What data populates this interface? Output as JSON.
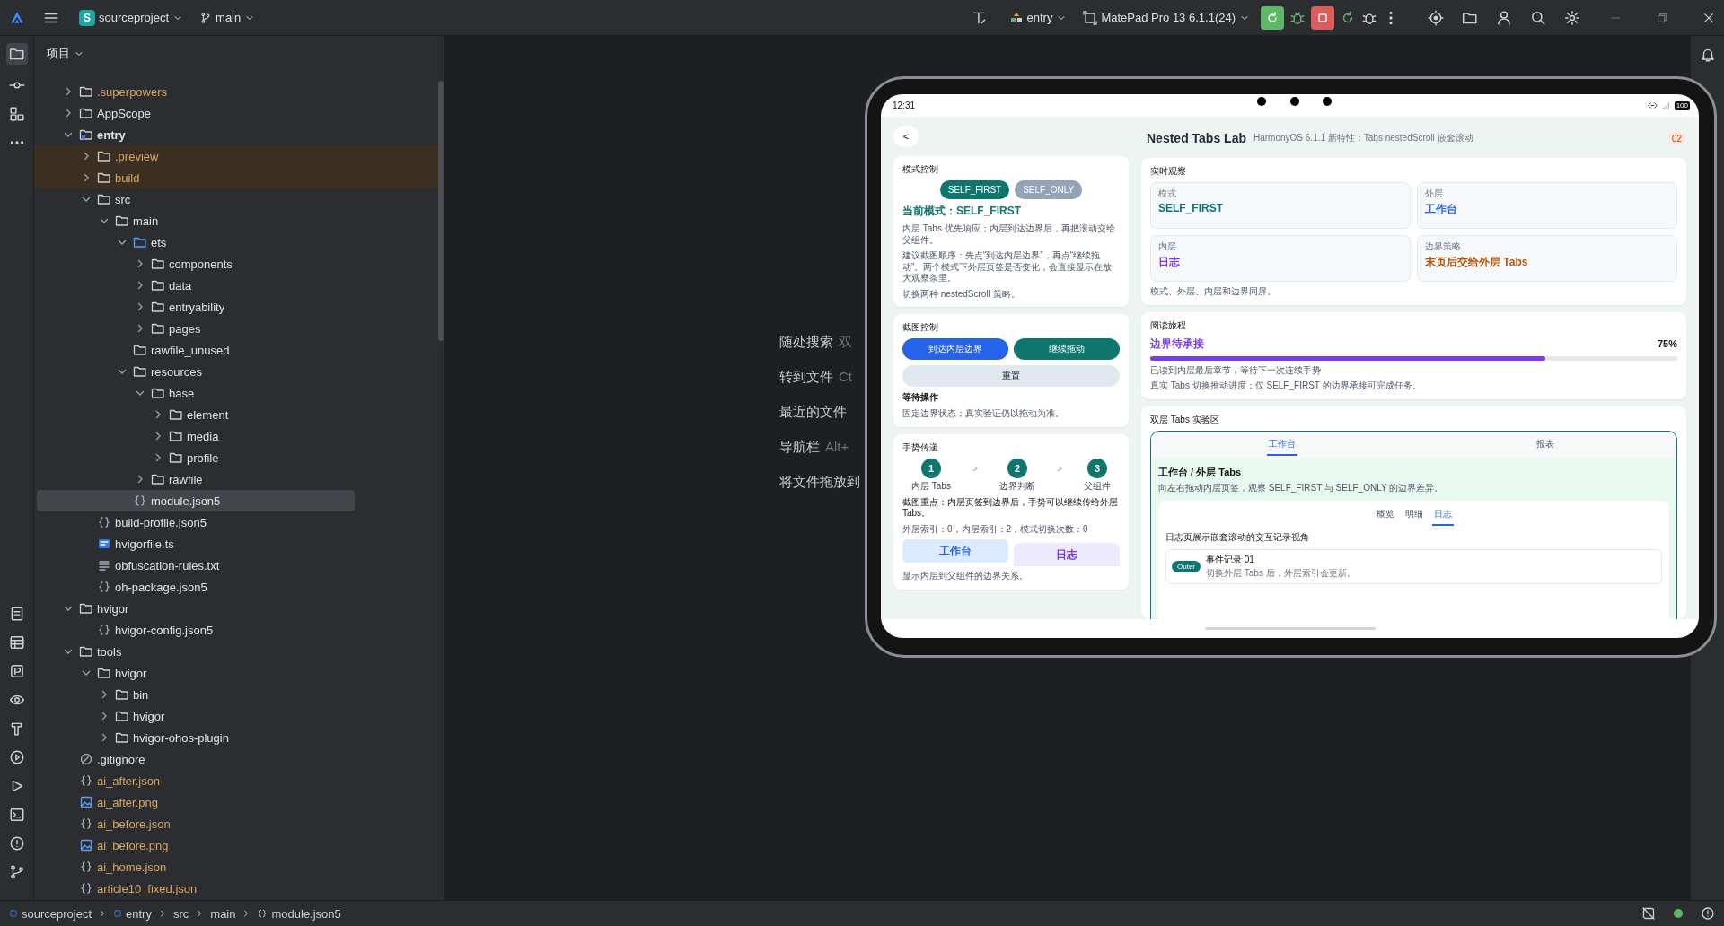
{
  "toolbar": {
    "project_badge": "S",
    "project": "sourceproject",
    "branch": "main",
    "run_config": "entry",
    "device": "MatePad Pro 13 6.1.1(24)"
  },
  "project_panel": {
    "title": "项目",
    "tree": [
      {
        "label": ".superpowers",
        "kind": "folder",
        "ignored": true,
        "excluded": false,
        "selected": false,
        "expanded": false
      },
      {
        "label": "AppScope",
        "kind": "folder",
        "ignored": false,
        "excluded": false,
        "selected": false,
        "expanded": false
      },
      {
        "label": "entry",
        "kind": "module",
        "ignored": false,
        "excluded": false,
        "selected": false,
        "expanded": true,
        "children": [
          {
            "label": ".preview",
            "kind": "folder",
            "ignored": true,
            "excluded": true,
            "selected": false,
            "expanded": false
          },
          {
            "label": "build",
            "kind": "folder",
            "ignored": true,
            "excluded": true,
            "selected": false,
            "expanded": false
          },
          {
            "label": "src",
            "kind": "folder",
            "ignored": false,
            "excluded": false,
            "selected": false,
            "expanded": true,
            "children": [
              {
                "label": "main",
                "kind": "folder",
                "ignored": false,
                "excluded": false,
                "selected": false,
                "expanded": true,
                "children": [
                  {
                    "label": "ets",
                    "kind": "source",
                    "ignored": false,
                    "excluded": false,
                    "selected": false,
                    "expanded": true,
                    "children": [
                      {
                        "label": "components",
                        "kind": "folder",
                        "ignored": false,
                        "excluded": false,
                        "selected": false,
                        "expanded": false
                      },
                      {
                        "label": "data",
                        "kind": "folder",
                        "ignored": false,
                        "excluded": false,
                        "selected": false,
                        "expanded": false
                      },
                      {
                        "label": "entryability",
                        "kind": "folder",
                        "ignored": false,
                        "excluded": false,
                        "selected": false,
                        "expanded": false
                      },
                      {
                        "label": "pages",
                        "kind": "folder",
                        "ignored": false,
                        "excluded": false,
                        "selected": false,
                        "expanded": false
                      }
                    ]
                  },
                  {
                    "label": "rawfile_unused",
                    "kind": "folder",
                    "ignored": false,
                    "excluded": false,
                    "selected": false
                  },
                  {
                    "label": "resources",
                    "kind": "folder",
                    "ignored": false,
                    "excluded": false,
                    "selected": false,
                    "expanded": true,
                    "children": [
                      {
                        "label": "base",
                        "kind": "folder",
                        "ignored": false,
                        "excluded": false,
                        "selected": false,
                        "expanded": true,
                        "children": [
                          {
                            "label": "element",
                            "kind": "folder",
                            "ignored": false,
                            "excluded": false,
                            "selected": false,
                            "expanded": false
                          },
                          {
                            "label": "media",
                            "kind": "folder",
                            "ignored": false,
                            "excluded": false,
                            "selected": false,
                            "expanded": false
                          },
                          {
                            "label": "profile",
                            "kind": "folder",
                            "ignored": false,
                            "excluded": false,
                            "selected": false,
                            "expanded": false
                          }
                        ]
                      },
                      {
                        "label": "rawfile",
                        "kind": "folder",
                        "ignored": false,
                        "excluded": false,
                        "selected": false,
                        "expanded": false
                      }
                    ]
                  },
                  {
                    "label": "module.json5",
                    "kind": "json",
                    "ignored": false,
                    "excluded": false,
                    "selected": true
                  }
                ]
              }
            ]
          },
          {
            "label": "build-profile.json5",
            "kind": "json",
            "ignored": false,
            "excluded": false,
            "selected": false
          },
          {
            "label": "hvigorfile.ts",
            "kind": "ts",
            "ignored": false,
            "excluded": false,
            "selected": false
          },
          {
            "label": "obfuscation-rules.txt",
            "kind": "txt",
            "ignored": false,
            "excluded": false,
            "selected": false
          },
          {
            "label": "oh-package.json5",
            "kind": "json",
            "ignored": false,
            "excluded": false,
            "selected": false
          }
        ]
      },
      {
        "label": "hvigor",
        "kind": "folder",
        "ignored": false,
        "excluded": false,
        "selected": false,
        "expanded": true,
        "children": [
          {
            "label": "hvigor-config.json5",
            "kind": "json",
            "ignored": false,
            "excluded": false,
            "selected": false
          }
        ]
      },
      {
        "label": "tools",
        "kind": "folder",
        "ignored": false,
        "excluded": false,
        "selected": false,
        "expanded": true,
        "children": [
          {
            "label": "hvigor",
            "kind": "folder",
            "ignored": false,
            "excluded": false,
            "selected": false,
            "expanded": true,
            "children": [
              {
                "label": "bin",
                "kind": "folder",
                "ignored": false,
                "excluded": false,
                "selected": false,
                "expanded": false
              },
              {
                "label": "hvigor",
                "kind": "folder",
                "ignored": false,
                "excluded": false,
                "selected": false,
                "expanded": false
              },
              {
                "label": "hvigor-ohos-plugin",
                "kind": "folder",
                "ignored": false,
                "excluded": false,
                "selected": false,
                "expanded": false
              }
            ]
          }
        ]
      },
      {
        "label": ".gitignore",
        "kind": "ignore",
        "ignored": false,
        "excluded": false,
        "selected": false
      },
      {
        "label": "ai_after.json",
        "kind": "json",
        "ignored": true,
        "excluded": false,
        "selected": false
      },
      {
        "label": "ai_after.png",
        "kind": "image",
        "ignored": true,
        "excluded": false,
        "selected": false
      },
      {
        "label": "ai_before.json",
        "kind": "json",
        "ignored": true,
        "excluded": false,
        "selected": false
      },
      {
        "label": "ai_before.png",
        "kind": "image",
        "ignored": true,
        "excluded": false,
        "selected": false
      },
      {
        "label": "ai_home.json",
        "kind": "json",
        "ignored": true,
        "excluded": false,
        "selected": false
      },
      {
        "label": "article10_fixed.json",
        "kind": "json",
        "ignored": true,
        "excluded": false,
        "selected": false
      }
    ]
  },
  "editor_hints": [
    {
      "action": "随处搜索",
      "shortcut": "双"
    },
    {
      "action": "转到文件",
      "shortcut": "Ct"
    },
    {
      "action": "最近的文件"
    },
    {
      "action": "导航栏",
      "shortcut": "Alt+"
    },
    {
      "action": "将文件拖放到"
    }
  ],
  "device": {
    "time": "12:31",
    "battery": "100",
    "app": {
      "back": "<",
      "title": "Nested Tabs Lab",
      "subtitle": "HarmonyOS 6.1.1 新特性：Tabs nestedScroll 嵌套滚动",
      "badge": "02",
      "mode_card": {
        "title": "模式控制",
        "modes": [
          {
            "label": "SELF_FIRST",
            "selected": true
          },
          {
            "label": "SELF_ONLY",
            "selected": false
          }
        ],
        "current": "当前模式：SELF_FIRST",
        "notes": [
          "内层 Tabs 优先响应；内层到达边界后，再把滚动交给父组件。",
          "建议截图顺序：先点“到达内层边界”，再点“继续拖动”。两个模式下外层页签是否变化，会直接显示在放大观察条里。",
          "切换两种 nestedScroll 策略。"
        ]
      },
      "capture_card": {
        "title": "截图控制",
        "buttons": [
          {
            "label": "到达内层边界",
            "kind": "primary"
          },
          {
            "label": "继续拖动",
            "kind": "accent"
          },
          {
            "label": "重置",
            "kind": "neutral"
          }
        ],
        "status": "等待操作",
        "note": "固定边界状态；真实验证仍以拖动为准。"
      },
      "gesture_card": {
        "title": "手势传递",
        "steps": [
          {
            "number": "1",
            "label": "内层 Tabs"
          },
          {
            "number": "2",
            "label": "边界判断"
          },
          {
            "number": "3",
            "label": "父组件"
          }
        ],
        "separators": [
          ">",
          ">"
        ],
        "highlight": "截图重点：内层页签到边界后，手势可以继续传给外层 Tabs。",
        "indices": "外层索引：0，内层索引：2，模式切换次数：0",
        "chips": [
          {
            "label": "工作台",
            "kind": "outer"
          },
          {
            "label": "日志",
            "kind": "inner"
          }
        ],
        "note": "显示内层到父组件的边界关系。"
      },
      "observe_card": {
        "title": "实时观察",
        "tiles": [
          {
            "label": "模式",
            "value": "SELF_FIRST",
            "color": "#0f766e"
          },
          {
            "label": "外层",
            "value": "工作台",
            "color": "#2563eb"
          },
          {
            "label": "内层",
            "value": "日志",
            "color": "#7c3aed"
          },
          {
            "label": "边界策略",
            "value": "末页后交给外层 Tabs",
            "color": "#b45309"
          }
        ],
        "note": "模式、外层、内层和边界同屏。"
      },
      "progress_card": {
        "title": "阅读旅程",
        "status": "边界待承接",
        "percent": "75%",
        "level": 0.75,
        "detail": "已读到内层最后章节，等待下一次连续手势",
        "note": "真实 Tabs 切换推动进度；仅 SELF_FIRST 的边界承接可完成任务。"
      },
      "lab_card": {
        "title": "双层 Tabs 实验区",
        "outer_tabs": [
          {
            "label": "工作台",
            "selected": true
          },
          {
            "label": "报表",
            "selected": false
          }
        ],
        "panel_title": "工作台 / 外层 Tabs",
        "panel_note": "向左右拖动内层页签，观察 SELF_FIRST 与 SELF_ONLY 的边界差异。",
        "inner_tabs": [
          {
            "label": "概览",
            "selected": false
          },
          {
            "label": "明细",
            "selected": false
          },
          {
            "label": "日志",
            "selected": true
          }
        ],
        "log_title": "日志页展示嵌套滚动的交互记录视角",
        "records": [
          {
            "tag": "Outer",
            "title": "事件记录 01",
            "detail": "切换外层 Tabs 后，外层索引会更新。"
          }
        ]
      }
    }
  },
  "breadcrumb": [
    {
      "label": "sourceproject",
      "kind": "module"
    },
    {
      "label": "entry",
      "kind": "module"
    },
    {
      "label": "src",
      "kind": "plain"
    },
    {
      "label": "main",
      "kind": "plain"
    },
    {
      "label": "module.json5",
      "kind": "json"
    }
  ]
}
